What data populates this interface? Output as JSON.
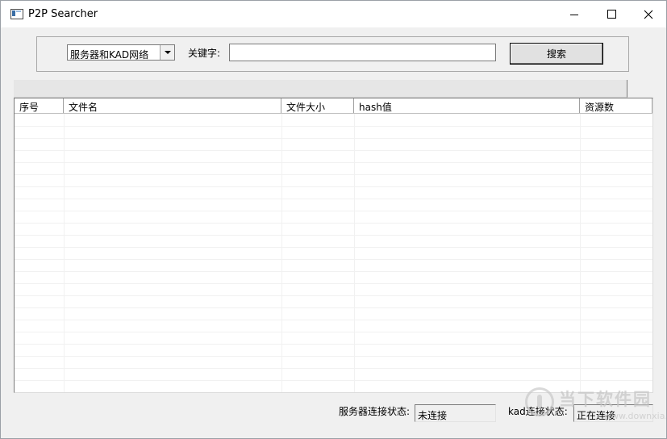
{
  "window": {
    "title": "P2P Searcher"
  },
  "search": {
    "scope_selected": "服务器和KAD网络",
    "keyword_label": "关键字:",
    "keyword_value": "",
    "search_button": "搜索"
  },
  "table": {
    "columns": [
      "序号",
      "文件名",
      "文件大小",
      "hash值",
      "资源数"
    ],
    "rows": []
  },
  "status": {
    "server_label": "服务器连接状态:",
    "server_value": "未连接",
    "kad_label": "kad连接状态:",
    "kad_value": "正在连接"
  },
  "watermark": {
    "name": "当下软件园",
    "url": "www.downxia.com"
  }
}
